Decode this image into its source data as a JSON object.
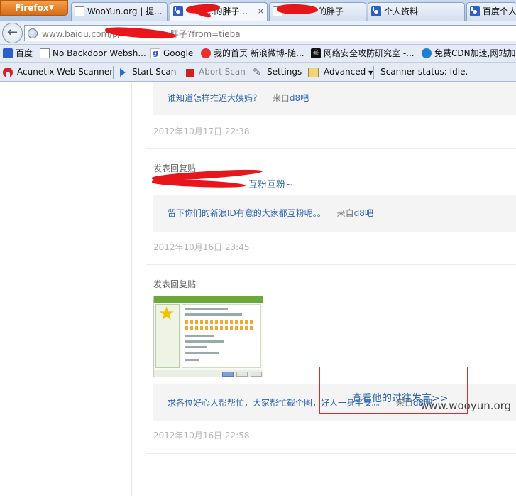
{
  "browser": {
    "menu_label": "Firefox",
    "tabs": [
      {
        "label": "WooYun.org | 提...",
        "icon": "page-icon",
        "active": false
      },
      {
        "label": "...的胖子...",
        "icon": "baidu-paw-icon",
        "active": true,
        "close": "×"
      },
      {
        "label": "的胖子",
        "icon": "page-icon",
        "active": false
      },
      {
        "label": "个人资料",
        "icon": "baidu-paw-icon",
        "active": false
      },
      {
        "label": "百度个人资",
        "icon": "baidu-paw-icon",
        "active": false
      }
    ],
    "url": "www.baidu.com/p/",
    "url_tail": "胖子?from=tieba"
  },
  "bookmarks": [
    {
      "label": "百度",
      "icon": "baidu-paw-icon"
    },
    {
      "label": "No Backdoor Websh...",
      "icon": "page-icon"
    },
    {
      "label": "Google",
      "icon": "google-icon"
    },
    {
      "label": "我的首页 新浪微博-随...",
      "icon": "weibo-icon"
    },
    {
      "label": "网络安全攻防研究室 -...",
      "icon": "skull-icon"
    },
    {
      "label": "免费CDN加速,网站加",
      "icon": "compass-icon"
    }
  ],
  "acunetix": {
    "title": "Acunetix Web Scanner",
    "start_scan": "Start Scan",
    "abort_scan": "Abort Scan",
    "settings": "Settings",
    "advanced": "Advanced",
    "status": "Scanner status: Idle."
  },
  "posts": {
    "p1": {
      "quote": "谁知道怎样推迟大姨妈？",
      "from_prefix": "来自",
      "from_link": "d8吧",
      "time": "2012年10月17日 22:38"
    },
    "p2": {
      "heading": "发表回复贴",
      "reply_suffix": "互粉互粉~",
      "quote": "留下你们的新浪ID有意的大家都互粉呢。。",
      "from_prefix": "来自",
      "from_link": "d8吧",
      "time": "2012年10月16日 23:45"
    },
    "p3": {
      "heading": "发表回复贴",
      "quote": "求各位好心人帮帮忙，大家帮忙截个图，好人一身平安。。",
      "from_prefix": "来自",
      "from_link": "d8吧",
      "time": "2012年10月16日 22:58"
    }
  },
  "more_link": "查看他的过往发言>>",
  "watermark": "www.wooyun.org"
}
